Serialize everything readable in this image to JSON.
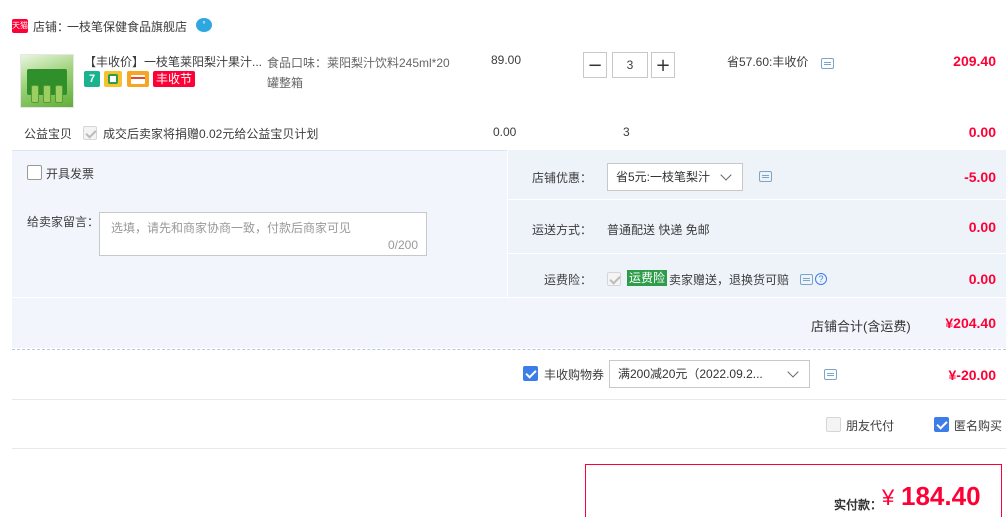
{
  "store": {
    "badge": "天猫",
    "label": "店铺：",
    "name": "一枝笔保健食品旗舰店",
    "chat_badge": "°"
  },
  "product": {
    "title": "【丰收价】一枝笔莱阳梨汁果汁...",
    "tag_7": "7",
    "tag_festival": "丰收节",
    "spec": "食品口味：莱阳梨汁饮料245ml*20罐整箱",
    "unit_price": "89.00",
    "quantity": "3",
    "minus": "−",
    "plus": "+",
    "discount": "省57.60:丰收价",
    "subtotal": "209.40"
  },
  "charity": {
    "label": "公益宝贝",
    "text": "成交后卖家将捐赠0.02元给公益宝贝计划",
    "price": "0.00",
    "quantity": "3",
    "subtotal": "0.00"
  },
  "invoice": {
    "label": "开具发票"
  },
  "message": {
    "label": "给卖家留言：",
    "placeholder": "选填，请先和商家协商一致，付款后商家可见",
    "counter": "0/200"
  },
  "shop_discount": {
    "label": "店铺优惠：",
    "value": "省5元:一枝笔梨汁",
    "amount": "-5.00"
  },
  "shipping": {
    "label": "运送方式：",
    "value": "普通配送 快递 免邮",
    "amount": "0.00"
  },
  "insurance": {
    "label": "运费险：",
    "tag": "运费险",
    "text": "卖家赠送，退换货可赔",
    "help": "?",
    "amount": "0.00"
  },
  "store_total": {
    "label": "店铺合计(含运费)",
    "amount": "¥204.40"
  },
  "coupon": {
    "label": "丰收购物券",
    "value": "满200减20元（2022.09.2...",
    "amount": "¥-20.00"
  },
  "options": {
    "friend_pay": "朋友代付",
    "anonymous": "匿名购买"
  },
  "payment": {
    "label": "实付款：",
    "currency": "¥",
    "amount": "184.40"
  },
  "colors": {
    "price_red": "#ff0036",
    "panel_blue": "#f2f6fc",
    "checkbox_blue": "#3d7de8",
    "insurance_green": "#2e9d4a"
  }
}
